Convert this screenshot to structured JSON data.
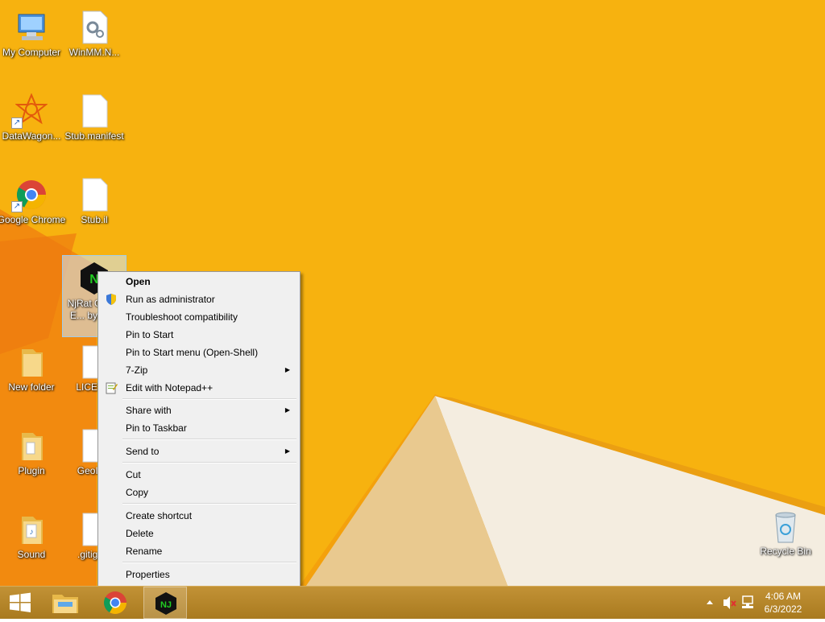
{
  "desktop": {
    "icons": [
      {
        "label": "My Computer"
      },
      {
        "label": "WinMM.N..."
      },
      {
        "label": "DataWagon..."
      },
      {
        "label": "Stub.manifest"
      },
      {
        "label": "Google Chrome"
      },
      {
        "label": "Stub.il"
      },
      {
        "label": "NjRat Green E... by im..."
      },
      {
        "label": "New folder"
      },
      {
        "label": "LICEN..."
      },
      {
        "label": "Plugin"
      },
      {
        "label": "GeoIP..."
      },
      {
        "label": "Sound"
      },
      {
        "label": ".gitign..."
      },
      {
        "label": "Recycle Bin"
      }
    ]
  },
  "context_menu": {
    "items": [
      {
        "label": "Open"
      },
      {
        "label": "Run as administrator"
      },
      {
        "label": "Troubleshoot compatibility"
      },
      {
        "label": "Pin to Start"
      },
      {
        "label": "Pin to Start menu (Open-Shell)"
      },
      {
        "label": "7-Zip"
      },
      {
        "label": "Edit with Notepad++"
      },
      {
        "label": "Share with"
      },
      {
        "label": "Pin to Taskbar"
      },
      {
        "label": "Send to"
      },
      {
        "label": "Cut"
      },
      {
        "label": "Copy"
      },
      {
        "label": "Create shortcut"
      },
      {
        "label": "Delete"
      },
      {
        "label": "Rename"
      },
      {
        "label": "Properties"
      }
    ]
  },
  "taskbar": {
    "clock_time": "4:06 AM",
    "clock_date": "6/3/2022",
    "njrat_icon_text": "NJ"
  },
  "colors": {
    "wallpaper": "#f7b20f",
    "taskbar": "#b98a2a",
    "menu_bg": "#f0f0f0"
  }
}
